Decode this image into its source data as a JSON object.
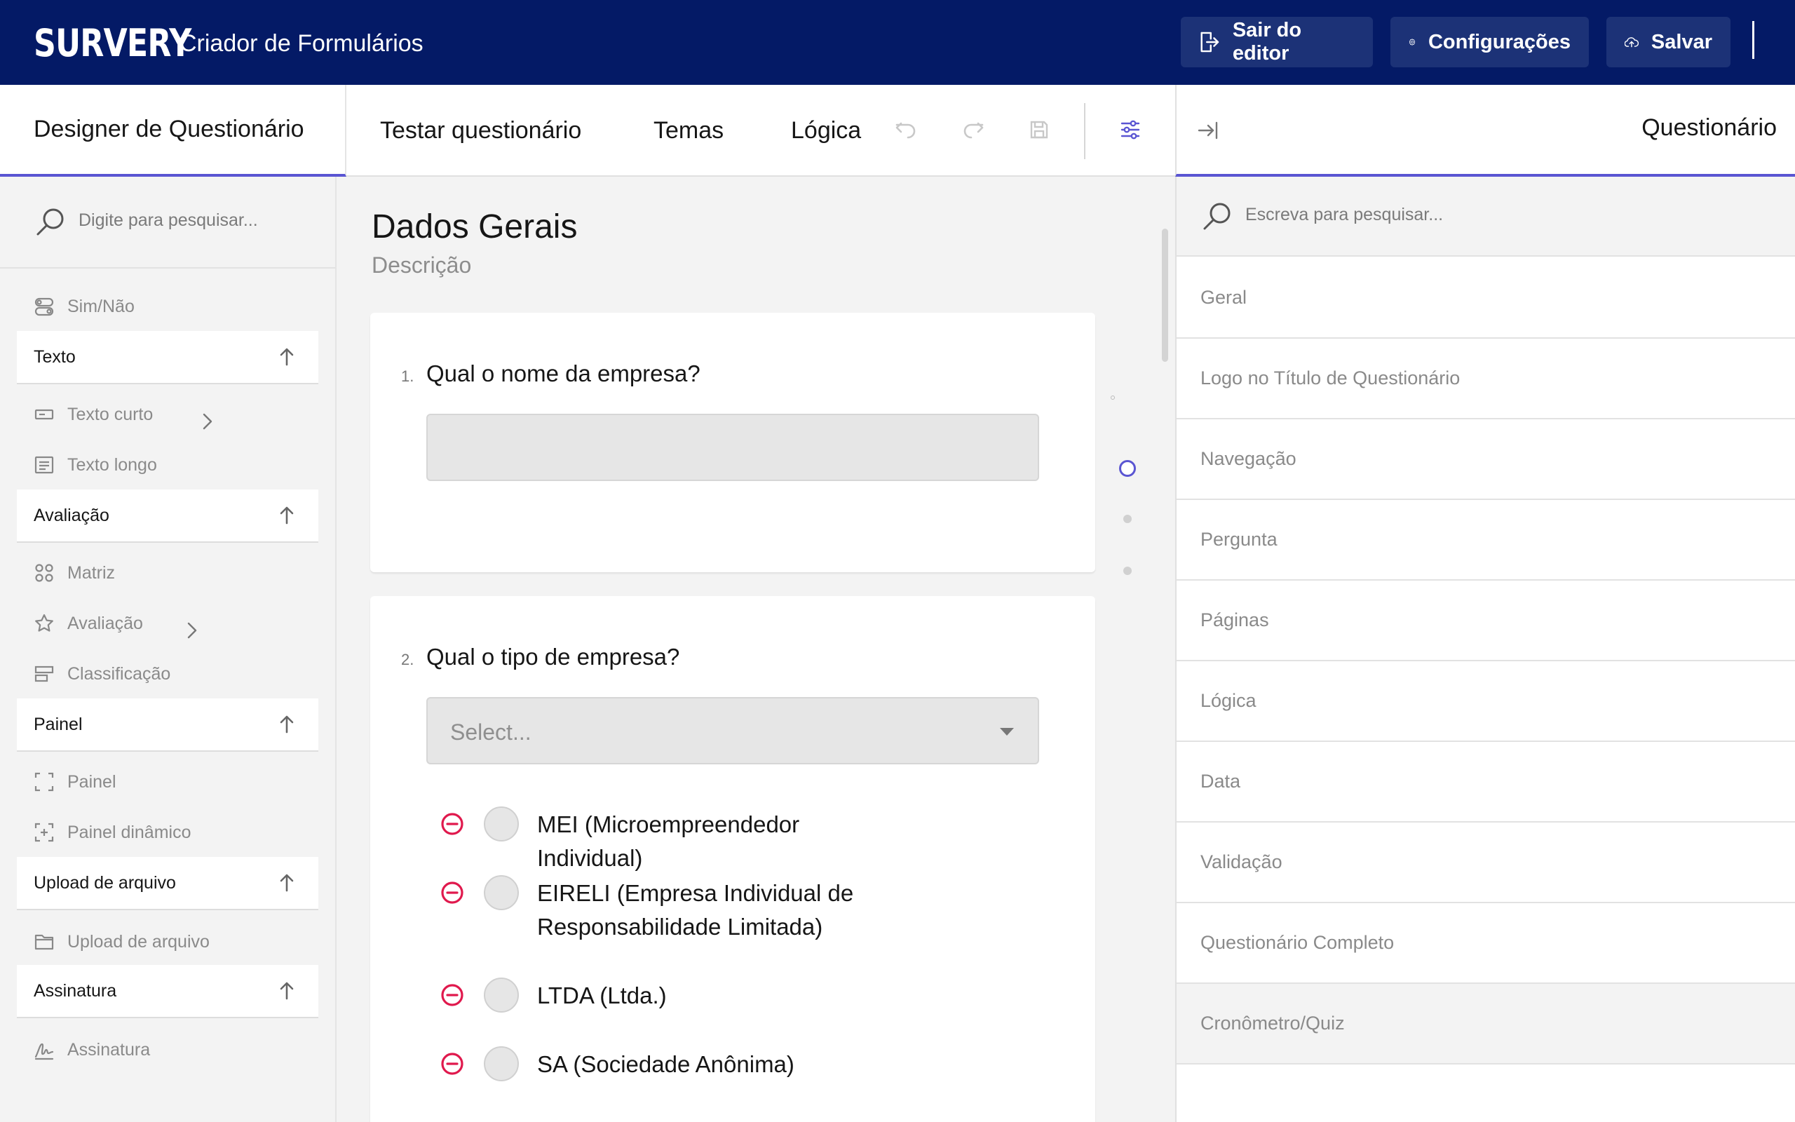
{
  "header": {
    "logo": "SURVERY",
    "title": "Criador de Formulários",
    "exit_label": "Sair do editor",
    "settings_label": "Configurações",
    "save_label": "Salvar"
  },
  "tabs": {
    "designer": "Designer de Questionário",
    "test": "Testar questionário",
    "themes": "Temas",
    "logic": "Lógica"
  },
  "toolbox": {
    "search_placeholder": "Digite para pesquisar...",
    "items": {
      "yesno": "Sim/Não",
      "short_text": "Texto curto",
      "long_text": "Texto longo",
      "matrix": "Matriz",
      "rating": "Avaliação",
      "ranking": "Classificação",
      "panel": "Painel",
      "dynamic_panel": "Painel dinâmico",
      "file_upload": "Upload de arquivo",
      "signature": "Assinatura"
    },
    "categories": {
      "text": "Texto",
      "rating": "Avaliação",
      "panel": "Painel",
      "upload": "Upload de arquivo",
      "signature": "Assinatura"
    }
  },
  "page": {
    "title": "Dados Gerais",
    "description": "Descrição",
    "questions": [
      {
        "number": "1.",
        "title": "Qual o nome da empresa?"
      },
      {
        "number": "2.",
        "title": "Qual o tipo de empresa?",
        "placeholder": "Select...",
        "choices": [
          "MEI (Microempreendedor Individual)",
          "EIRELI (Empresa Individual de Responsabilidade Limitada)",
          "LTDA (Ltda.)",
          "SA (Sociedade Anônima)"
        ]
      }
    ]
  },
  "property_grid": {
    "title": "Questionário",
    "search_placeholder": "Escreva para pesquisar...",
    "categories": [
      "Geral",
      "Logo no Título de Questionário",
      "Navegação",
      "Pergunta",
      "Páginas",
      "Lógica",
      "Data",
      "Validação",
      "Questionário Completo",
      "Cronômetro/Quiz"
    ]
  },
  "colors": {
    "header_bg": "#041a66",
    "accent": "#5a55d2",
    "remove": "#e0194d"
  }
}
